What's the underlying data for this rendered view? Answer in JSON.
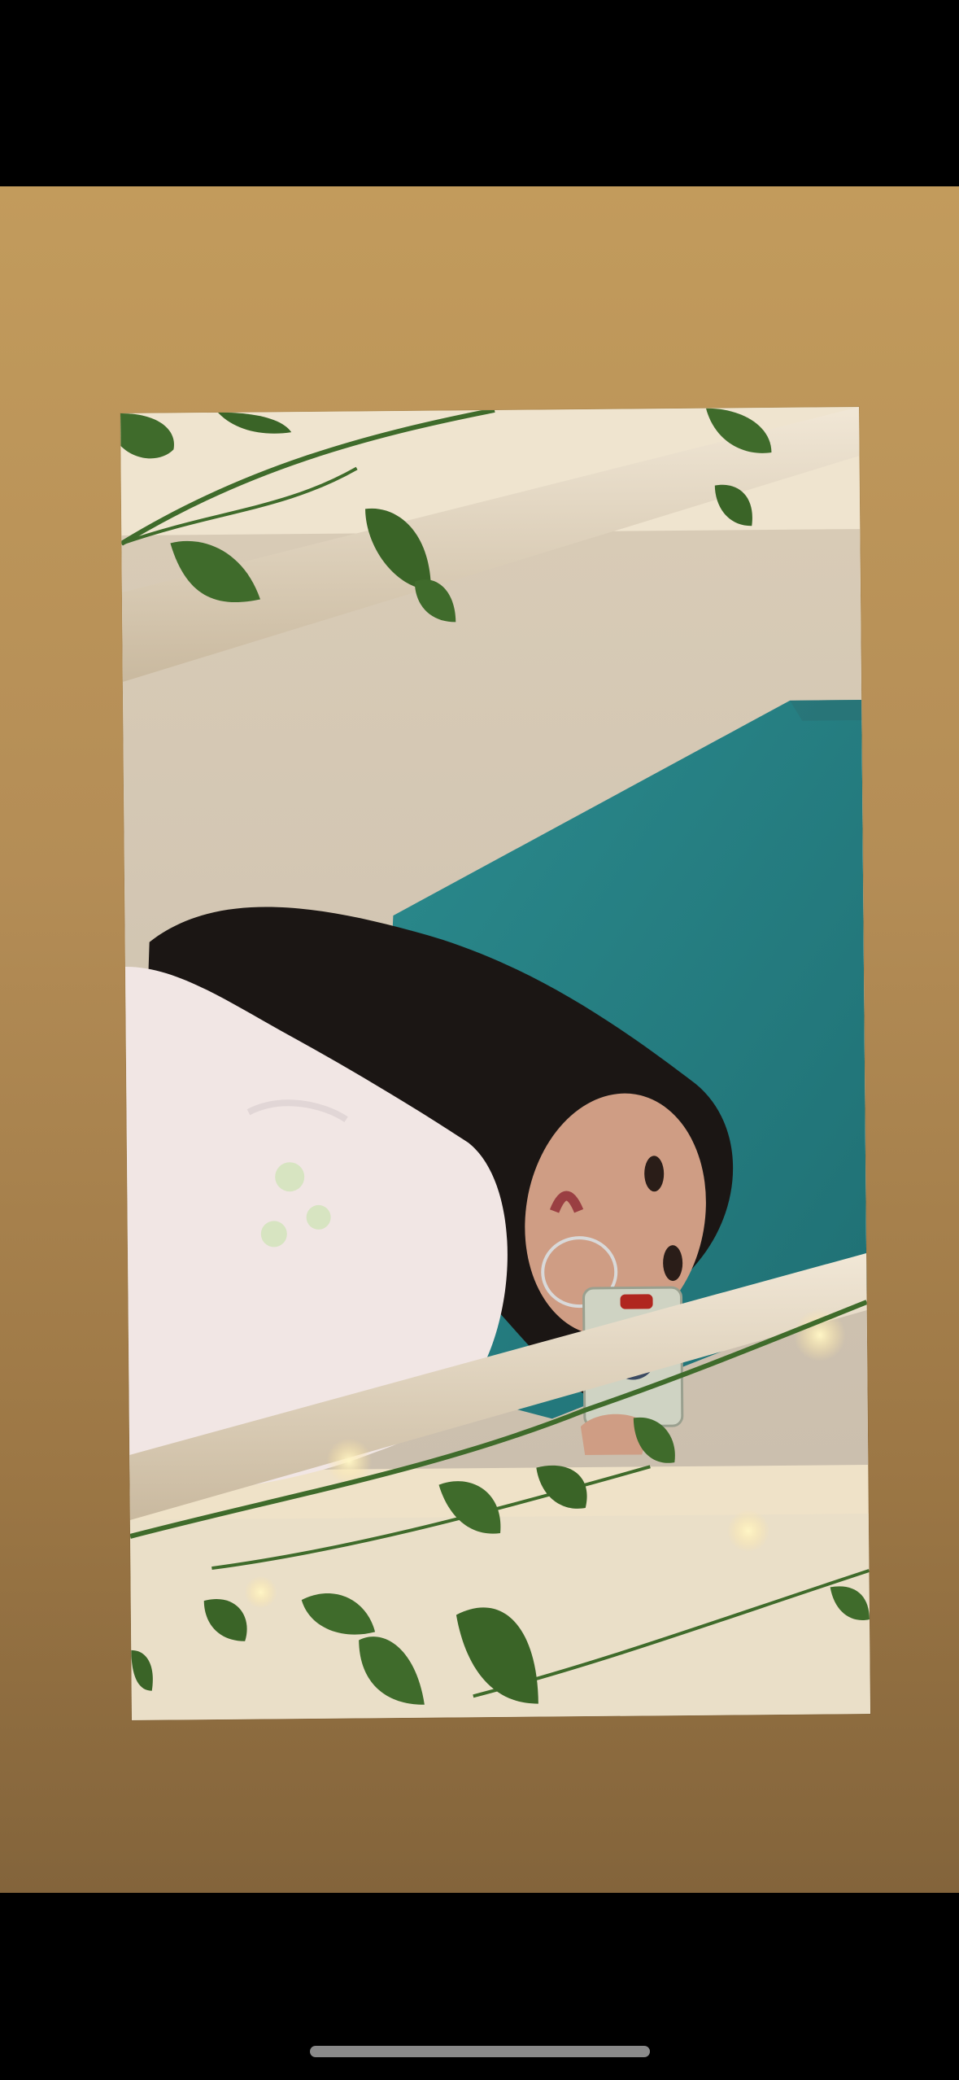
{
  "app": {
    "screen_type": "story-viewer",
    "background_gradient": [
      "#c29b5c",
      "#83643b"
    ]
  },
  "photo": {
    "subject": "mirror-selfie",
    "palette": {
      "wall": "#d9cdbb",
      "teal_board": "#2e8f92",
      "shirt": "#f1e6e4",
      "hair": "#1b1614",
      "skin": "#cf9d84",
      "leaf": "#3f6b2b",
      "frame": "#e7dcc9",
      "fairy_light": "#ffe6a3"
    }
  },
  "system": {
    "home_indicator": true
  }
}
